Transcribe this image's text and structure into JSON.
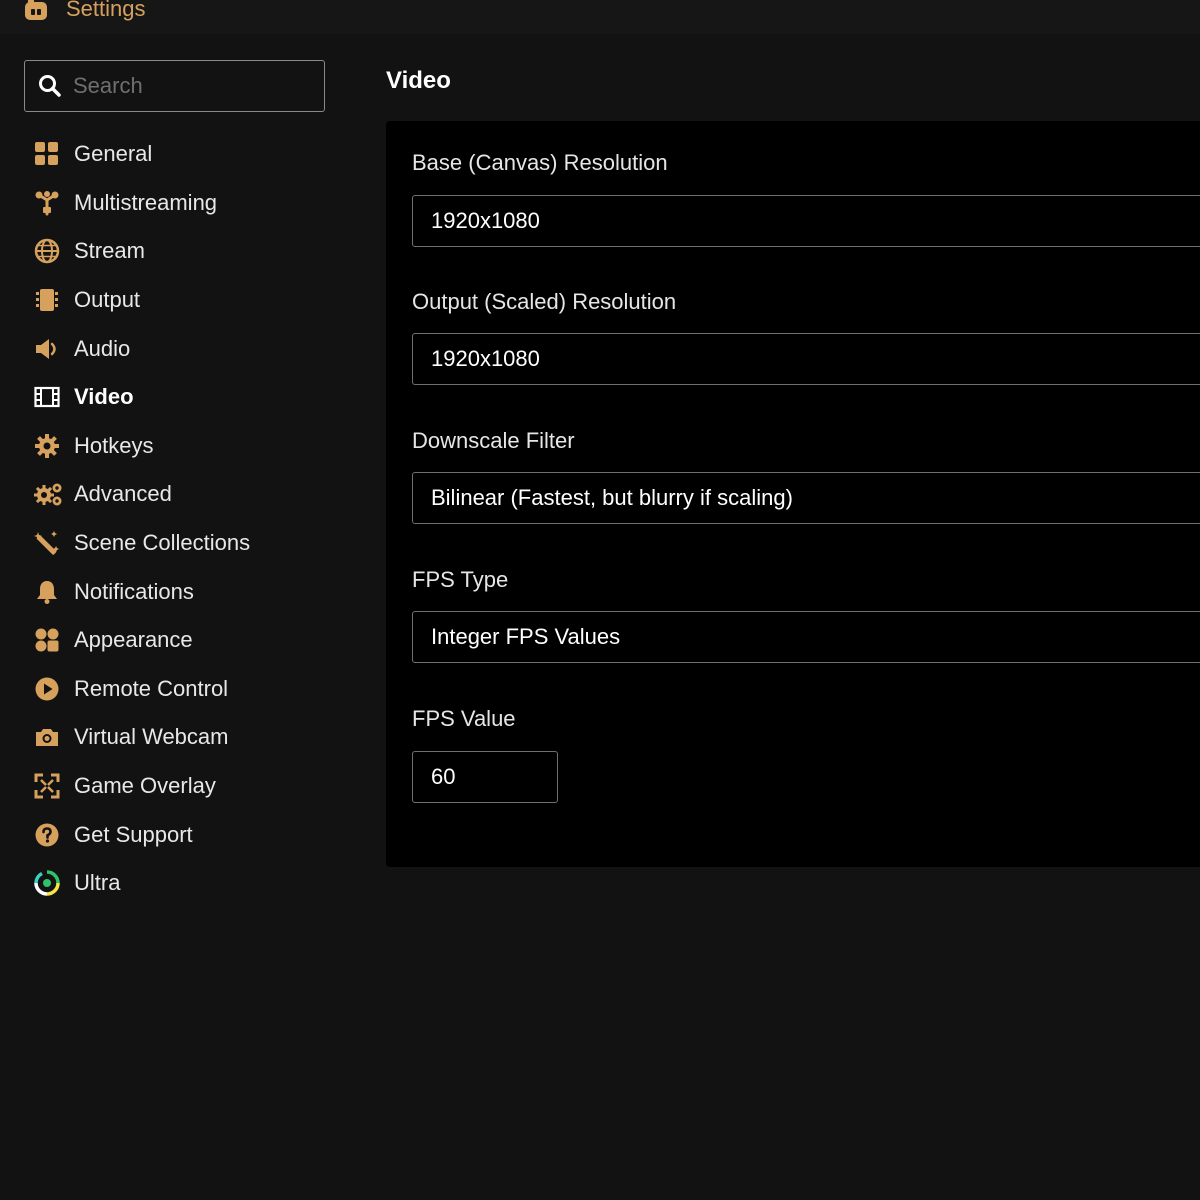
{
  "window": {
    "title": "Settings",
    "icon": "app-logo-icon"
  },
  "search": {
    "placeholder": "Search",
    "value": ""
  },
  "sidebar": {
    "items": [
      {
        "label": "General",
        "icon": "grid-icon"
      },
      {
        "label": "Multistreaming",
        "icon": "multistream-icon"
      },
      {
        "label": "Stream",
        "icon": "globe-icon"
      },
      {
        "label": "Output",
        "icon": "output-icon"
      },
      {
        "label": "Audio",
        "icon": "speaker-icon"
      },
      {
        "label": "Video",
        "icon": "film-icon",
        "active": true
      },
      {
        "label": "Hotkeys",
        "icon": "gear-icon"
      },
      {
        "label": "Advanced",
        "icon": "gears-icon"
      },
      {
        "label": "Scene Collections",
        "icon": "magic-wand-icon"
      },
      {
        "label": "Notifications",
        "icon": "bell-icon"
      },
      {
        "label": "Appearance",
        "icon": "palette-icon"
      },
      {
        "label": "Remote Control",
        "icon": "play-circle-icon"
      },
      {
        "label": "Virtual Webcam",
        "icon": "camera-icon"
      },
      {
        "label": "Game Overlay",
        "icon": "overlay-icon"
      },
      {
        "label": "Get Support",
        "icon": "question-icon"
      },
      {
        "label": "Ultra",
        "icon": "ultra-icon"
      }
    ]
  },
  "main": {
    "title": "Video",
    "fields": {
      "base_resolution": {
        "label": "Base (Canvas) Resolution",
        "value": "1920x1080"
      },
      "output_resolution": {
        "label": "Output (Scaled) Resolution",
        "value": "1920x1080"
      },
      "downscale_filter": {
        "label": "Downscale Filter",
        "value": "Bilinear (Fastest, but blurry if scaling)"
      },
      "fps_type": {
        "label": "FPS Type",
        "value": "Integer FPS Values"
      },
      "fps_value": {
        "label": "FPS Value",
        "value": "60"
      }
    }
  },
  "colors": {
    "accent": "#d6a15d",
    "background": "#121212",
    "panel": "#000000",
    "text": "#ffffff"
  }
}
